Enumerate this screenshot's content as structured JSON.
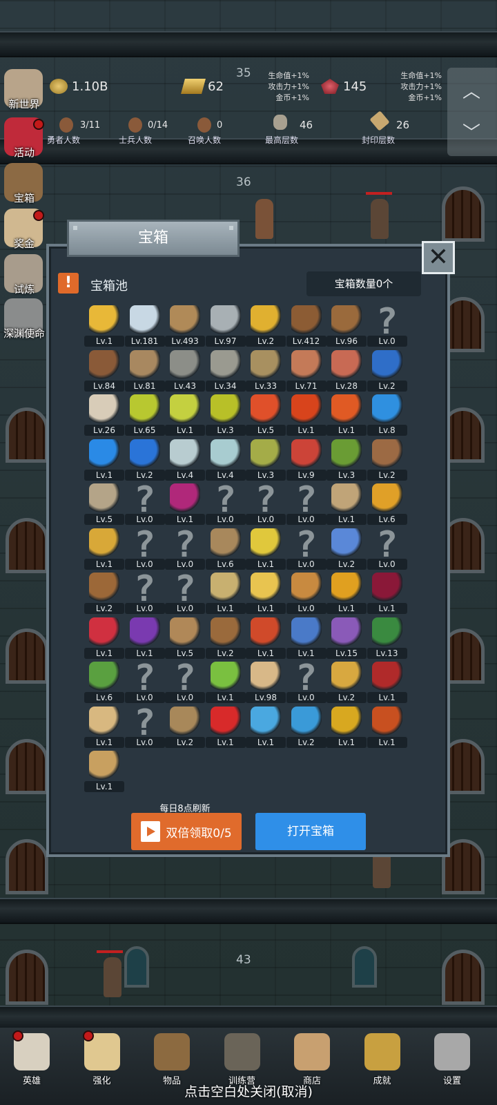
{
  "floors": {
    "f35": "35",
    "f36": "36",
    "f43": "43"
  },
  "stats": {
    "coins": "1.10B",
    "gold": "62",
    "gems": "145",
    "bonus_left": [
      "生命值+1%",
      "攻击力+1%",
      "金币+1%"
    ],
    "bonus_right": [
      "生命值+1%",
      "攻击力+1%",
      "金币+1%"
    ],
    "heroes_value": "3/11",
    "heroes_label": "勇者人数",
    "soldiers_value": "0/14",
    "soldiers_label": "士兵人数",
    "summon_value": "0",
    "summon_label": "召唤人数",
    "max_floor_value": "46",
    "max_floor_label": "最高层数",
    "seal_floor_value": "26",
    "seal_floor_label": "封印层数"
  },
  "side_menu": [
    {
      "label": "新世界",
      "icon": "scroll-map-icon",
      "dot": false
    },
    {
      "label": "活动",
      "icon": "heart-icon",
      "dot": true
    },
    {
      "label": "宝箱",
      "icon": "chest-icon",
      "dot": false
    },
    {
      "label": "奖金",
      "icon": "envelope-icon",
      "dot": true
    },
    {
      "label": "试炼",
      "icon": "feather-icon",
      "dot": false
    },
    {
      "label": "深渊使命",
      "icon": "orb-icon",
      "dot": false
    }
  ],
  "dialog": {
    "title": "宝箱",
    "pool_label": "宝箱池",
    "chest_count": "宝箱数量0个",
    "refresh_note": "每日8点刷新",
    "double_btn": "双倍领取0/5",
    "open_btn": "打开宝箱"
  },
  "items": [
    {
      "lv": "Lv.1",
      "icon": "crown-icon",
      "color": "#e8b838"
    },
    {
      "lv": "Lv.181",
      "icon": "diamond-icon",
      "color": "#c8d8e4"
    },
    {
      "lv": "Lv.493",
      "icon": "wooden-sword-icon",
      "color": "#b08a58"
    },
    {
      "lv": "Lv.97",
      "icon": "iron-sword-icon",
      "color": "#a8b0b4"
    },
    {
      "lv": "Lv.2",
      "icon": "gold-sword-icon",
      "color": "#e0b030"
    },
    {
      "lv": "Lv.412",
      "icon": "leather-armor-icon",
      "color": "#8c5c34"
    },
    {
      "lv": "Lv.96",
      "icon": "backpack-icon",
      "color": "#9a6a3c"
    },
    {
      "lv": "Lv.0",
      "icon": "unknown-icon",
      "color": ""
    },
    {
      "lv": "Lv.84",
      "icon": "leather-helmet-icon",
      "color": "#8a5a38"
    },
    {
      "lv": "Lv.81",
      "icon": "dagger-icon",
      "color": "#a88860"
    },
    {
      "lv": "Lv.43",
      "icon": "iron-helmet-icon",
      "color": "#8c8e88"
    },
    {
      "lv": "Lv.34",
      "icon": "hammer-icon",
      "color": "#9a9a90"
    },
    {
      "lv": "Lv.33",
      "icon": "knight-helmet-icon",
      "color": "#a89060"
    },
    {
      "lv": "Lv.71",
      "icon": "meat-leg-icon",
      "color": "#c47a58"
    },
    {
      "lv": "Lv.28",
      "icon": "steak-icon",
      "color": "#c86a54"
    },
    {
      "lv": "Lv.2",
      "icon": "blue-sack-icon",
      "color": "#2f6ec8"
    },
    {
      "lv": "Lv.26",
      "icon": "rice-bowl-icon",
      "color": "#d8ccb8"
    },
    {
      "lv": "Lv.65",
      "icon": "yellow-potion-icon",
      "color": "#b8c830"
    },
    {
      "lv": "Lv.1",
      "icon": "yellow-potion-large-icon",
      "color": "#c4d040"
    },
    {
      "lv": "Lv.3",
      "icon": "yellow-flask-icon",
      "color": "#b8c028"
    },
    {
      "lv": "Lv.5",
      "icon": "red-potion-icon",
      "color": "#e0502a"
    },
    {
      "lv": "Lv.1",
      "icon": "red-potion-large-icon",
      "color": "#d8441c"
    },
    {
      "lv": "Lv.1",
      "icon": "red-flask-icon",
      "color": "#e05a24"
    },
    {
      "lv": "Lv.8",
      "icon": "blue-potion-icon",
      "color": "#2f90e0"
    },
    {
      "lv": "Lv.1",
      "icon": "blue-potion-large-icon",
      "color": "#2a8ae6"
    },
    {
      "lv": "Lv.2",
      "icon": "blue-flask-icon",
      "color": "#2a74d8"
    },
    {
      "lv": "Lv.4",
      "icon": "white-vial-icon",
      "color": "#b8ccd0"
    },
    {
      "lv": "Lv.4",
      "icon": "cyan-vial-icon",
      "color": "#a8ccd0"
    },
    {
      "lv": "Lv.3",
      "icon": "green-bottle-icon",
      "color": "#a4ac48"
    },
    {
      "lv": "Lv.9",
      "icon": "red-vial-icon",
      "color": "#cc4438"
    },
    {
      "lv": "Lv.3",
      "icon": "winged-boot-icon",
      "color": "#6a9c34"
    },
    {
      "lv": "Lv.2",
      "icon": "leather-boot-icon",
      "color": "#9c6a44"
    },
    {
      "lv": "Lv.5",
      "icon": "cloth-boot-icon",
      "color": "#b4a488"
    },
    {
      "lv": "Lv.0",
      "icon": "unknown-icon",
      "color": ""
    },
    {
      "lv": "Lv.1",
      "icon": "purple-boot-icon",
      "color": "#b0287a"
    },
    {
      "lv": "Lv.0",
      "icon": "unknown-icon",
      "color": ""
    },
    {
      "lv": "Lv.0",
      "icon": "unknown-icon",
      "color": ""
    },
    {
      "lv": "Lv.0",
      "icon": "unknown-icon",
      "color": ""
    },
    {
      "lv": "Lv.1",
      "icon": "short-sword-icon",
      "color": "#c0a478"
    },
    {
      "lv": "Lv.6",
      "icon": "torch-icon",
      "color": "#e0a028"
    },
    {
      "lv": "Lv.1",
      "icon": "gold-staff-icon",
      "color": "#d8a838"
    },
    {
      "lv": "Lv.0",
      "icon": "unknown-icon",
      "color": ""
    },
    {
      "lv": "Lv.0",
      "icon": "unknown-icon",
      "color": ""
    },
    {
      "lv": "Lv.6",
      "icon": "wooden-staff-icon",
      "color": "#a8885c"
    },
    {
      "lv": "Lv.1",
      "icon": "lemon-icon",
      "color": "#e0c83c"
    },
    {
      "lv": "Lv.0",
      "icon": "unknown-icon",
      "color": ""
    },
    {
      "lv": "Lv.2",
      "icon": "blue-wand-icon",
      "color": "#5a88d8"
    },
    {
      "lv": "Lv.0",
      "icon": "unknown-icon",
      "color": ""
    },
    {
      "lv": "Lv.2",
      "icon": "leather-bag-icon",
      "color": "#9c6838"
    },
    {
      "lv": "Lv.0",
      "icon": "unknown-icon",
      "color": ""
    },
    {
      "lv": "Lv.0",
      "icon": "unknown-icon",
      "color": ""
    },
    {
      "lv": "Lv.1",
      "icon": "broom-icon",
      "color": "#c8b070"
    },
    {
      "lv": "Lv.1",
      "icon": "cheese-icon",
      "color": "#e8c450"
    },
    {
      "lv": "Lv.0",
      "icon": "pie-icon",
      "color": "#c88a40"
    },
    {
      "lv": "Lv.1",
      "icon": "honey-jar-icon",
      "color": "#e0a020"
    },
    {
      "lv": "Lv.1",
      "icon": "dark-crystal-icon",
      "color": "#8a1838"
    },
    {
      "lv": "Lv.1",
      "icon": "red-orb-stand-icon",
      "color": "#d03040"
    },
    {
      "lv": "Lv.1",
      "icon": "rainbow-gem-icon",
      "color": "#7a3ab0"
    },
    {
      "lv": "Lv.5",
      "icon": "bow-icon",
      "color": "#b08858"
    },
    {
      "lv": "Lv.2",
      "icon": "quiver-icon",
      "color": "#9a6a3c"
    },
    {
      "lv": "Lv.1",
      "icon": "fire-gauntlet-icon",
      "color": "#d04a2a"
    },
    {
      "lv": "Lv.1",
      "icon": "blue-gauntlet-icon",
      "color": "#4a7ac8"
    },
    {
      "lv": "Lv.15",
      "icon": "tentacle-icon",
      "color": "#8a5ab8"
    },
    {
      "lv": "Lv.13",
      "icon": "rune-amulet-icon",
      "color": "#3a8a40"
    },
    {
      "lv": "Lv.6",
      "icon": "gem-scroll-icon",
      "color": "#5aa040"
    },
    {
      "lv": "Lv.0",
      "icon": "unknown-icon",
      "color": ""
    },
    {
      "lv": "Lv.0",
      "icon": "unknown-icon",
      "color": ""
    },
    {
      "lv": "Lv.1",
      "icon": "green-scepter-icon",
      "color": "#7ac040"
    },
    {
      "lv": "Lv.98",
      "icon": "beer-mug-icon",
      "color": "#d8b888"
    },
    {
      "lv": "Lv.0",
      "icon": "unknown-icon",
      "color": ""
    },
    {
      "lv": "Lv.2",
      "icon": "pickaxe-icon",
      "color": "#d8a840"
    },
    {
      "lv": "Lv.1",
      "icon": "red-book-icon",
      "color": "#b02a2a"
    },
    {
      "lv": "Lv.1",
      "icon": "parchment-icon",
      "color": "#d8b880"
    },
    {
      "lv": "Lv.0",
      "icon": "unknown-icon",
      "color": ""
    },
    {
      "lv": "Lv.2",
      "icon": "rope-icon",
      "color": "#a8885a"
    },
    {
      "lv": "Lv.1",
      "icon": "red-banner-icon",
      "color": "#d82a2a"
    },
    {
      "lv": "Lv.1",
      "icon": "crystal-ball-icon",
      "color": "#4aa8e0"
    },
    {
      "lv": "Lv.2",
      "icon": "blue-rune-icon",
      "color": "#3a9ad8"
    },
    {
      "lv": "Lv.1",
      "icon": "gold-orb-icon",
      "color": "#d8a820"
    },
    {
      "lv": "Lv.1",
      "icon": "fire-rod-icon",
      "color": "#c85020"
    },
    {
      "lv": "Lv.1",
      "icon": "sun-tablet-icon",
      "color": "#c8a060"
    }
  ],
  "nav": [
    {
      "label": "英雄",
      "icon": "skull-icon",
      "dot": true
    },
    {
      "label": "强化",
      "icon": "candle-icon",
      "dot": true
    },
    {
      "label": "物品",
      "icon": "book-icon",
      "dot": false
    },
    {
      "label": "训练营",
      "icon": "lantern-icon",
      "dot": false
    },
    {
      "label": "商店",
      "icon": "mug-icon",
      "dot": false
    },
    {
      "label": "成就",
      "icon": "key-icon",
      "dot": false
    },
    {
      "label": "设置",
      "icon": "gear-icon",
      "dot": false
    }
  ],
  "close_hint": "点击空白处关闭(取消)"
}
